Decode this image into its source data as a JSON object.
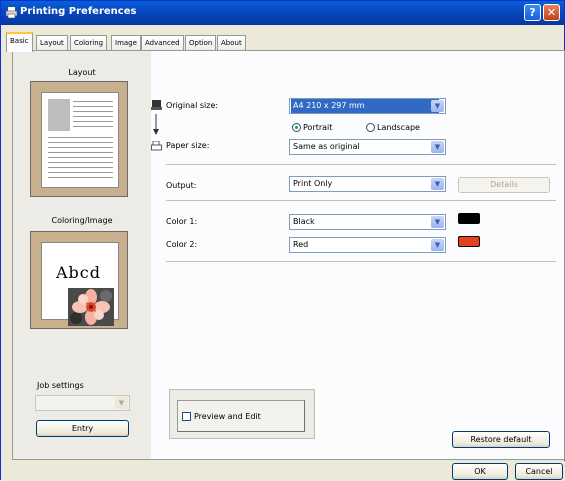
{
  "window": {
    "title": "Printing Preferences",
    "help_glyph": "?",
    "close_glyph": "✕"
  },
  "tabs": [
    "Basic",
    "Layout",
    "Coloring",
    "Image",
    "Advanced",
    "Option",
    "About"
  ],
  "sidebar": {
    "layout_label": "Layout",
    "coloring_label": "Coloring/Image",
    "abcd_text": "Abcd",
    "job_settings_label": "Job settings",
    "entry_button": "Entry"
  },
  "form": {
    "original_size_label": "Original size:",
    "original_size_value": "A4 210 x 297 mm",
    "portrait_label": "Portrait",
    "landscape_label": "Landscape",
    "orientation_selected": "Portrait",
    "paper_size_label": "Paper size:",
    "paper_size_value": "Same as original",
    "output_label": "Output:",
    "output_value": "Print Only",
    "details_button": "Details",
    "color1_label": "Color 1:",
    "color1_value": "Black",
    "color1_swatch": "#000000",
    "color2_label": "Color 2:",
    "color2_value": "Red",
    "color2_swatch": "#e8401c",
    "preview_edit_label": "Preview and Edit",
    "restore_button": "Restore default"
  },
  "footer": {
    "ok_button": "OK",
    "cancel_button": "Cancel"
  },
  "icons": {
    "dropdown_glyph": "▼"
  }
}
